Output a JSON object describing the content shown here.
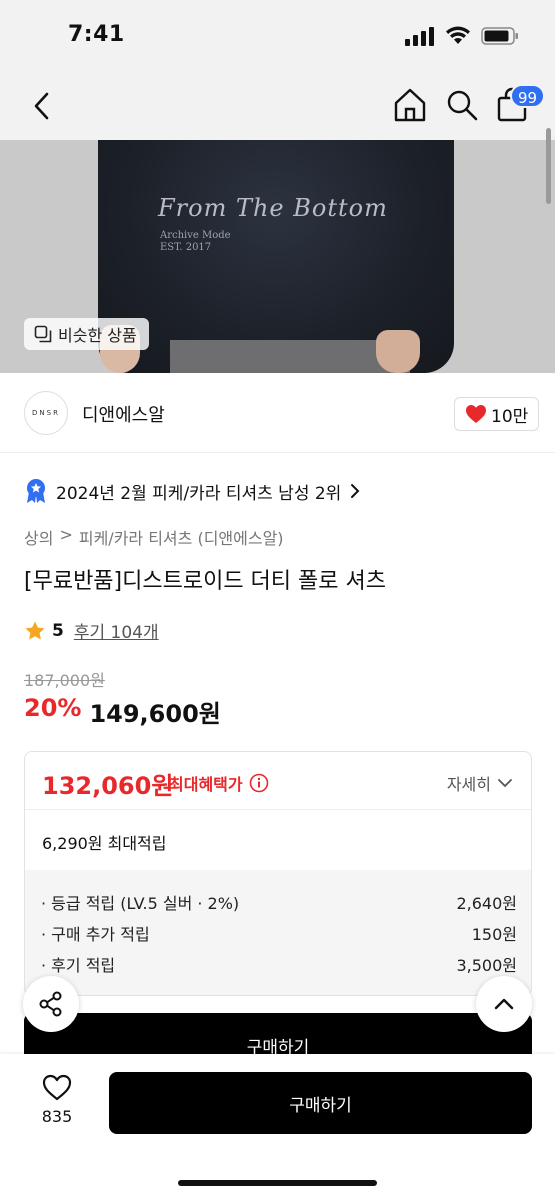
{
  "status_bar": {
    "time": "7:41"
  },
  "nav": {
    "cart_badge": "99"
  },
  "hero": {
    "script_text": "From The Bottom",
    "sub_text_1": "Archive Mode",
    "sub_text_2": "EST. 2017",
    "similar_label": "비슷한 상품"
  },
  "brand": {
    "logo_text": "DNSR",
    "name": "디앤에스알",
    "likes": "10만"
  },
  "rank": {
    "text": "2024년 2월 피케/카라 티셔츠 남성 2위"
  },
  "breadcrumb": {
    "level1": "상의",
    "sep": ">",
    "level2": "피케/카라 티셔츠 (디앤에스알)"
  },
  "product": {
    "title": "[무료반품]디스트로이드 더티 폴로 셔츠",
    "rating": "5",
    "review_label": "후기 104개",
    "original_price": "187,000원",
    "discount": "20%",
    "price": "149,600원"
  },
  "benefit": {
    "max_price": "132,060원",
    "max_label": "최대혜택가",
    "detail_label": "자세히",
    "points_total": "6,290원 최대적립",
    "points": [
      {
        "label": "· 등급 적립 (LV.5 실버 · 2%)",
        "value": "2,640원"
      },
      {
        "label": "· 구매 추가 적립",
        "value": "150원"
      },
      {
        "label": "· 후기 적립",
        "value": "3,500원"
      }
    ]
  },
  "inline_buy_label": "구매하기",
  "bottom": {
    "like_count": "835",
    "buy_label": "구매하기"
  },
  "colors": {
    "accent_red": "#e8292b",
    "badge_blue": "#2f6ff0",
    "heart": "#e8292b"
  }
}
